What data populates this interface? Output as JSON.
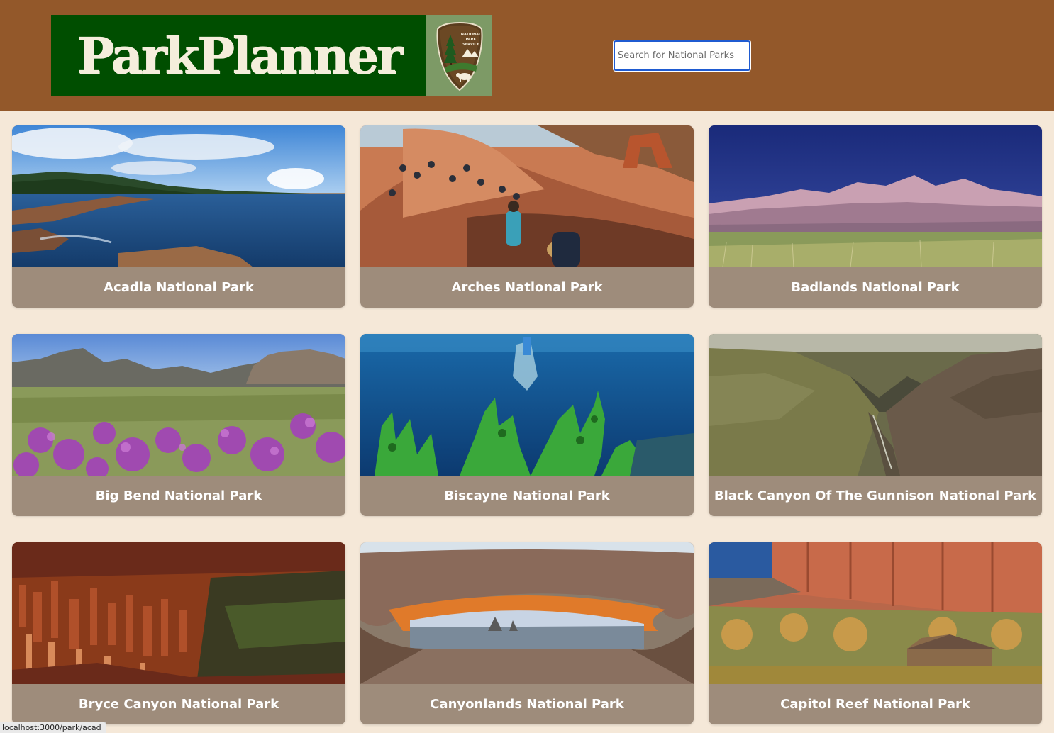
{
  "header": {
    "logo_text": "ParkPlanner",
    "badge_lines": [
      "NATIONAL",
      "PARK",
      "SERVICE"
    ],
    "search": {
      "placeholder": "Search for National Parks",
      "value": ""
    }
  },
  "parks": [
    {
      "name": "Acadia National Park"
    },
    {
      "name": "Arches National Park"
    },
    {
      "name": "Badlands National Park"
    },
    {
      "name": "Big Bend National Park"
    },
    {
      "name": "Biscayne National Park"
    },
    {
      "name": "Black Canyon Of The Gunnison National Park"
    },
    {
      "name": "Bryce Canyon National Park"
    },
    {
      "name": "Canyonlands National Park"
    },
    {
      "name": "Capitol Reef National Park"
    }
  ],
  "status_bar": {
    "url": "localhost:3000/park/acad"
  },
  "colors": {
    "header_bg": "#93582a",
    "logo_green": "#004e00",
    "page_bg": "#f5e8d8",
    "card_bg": "#9e8c7b"
  }
}
